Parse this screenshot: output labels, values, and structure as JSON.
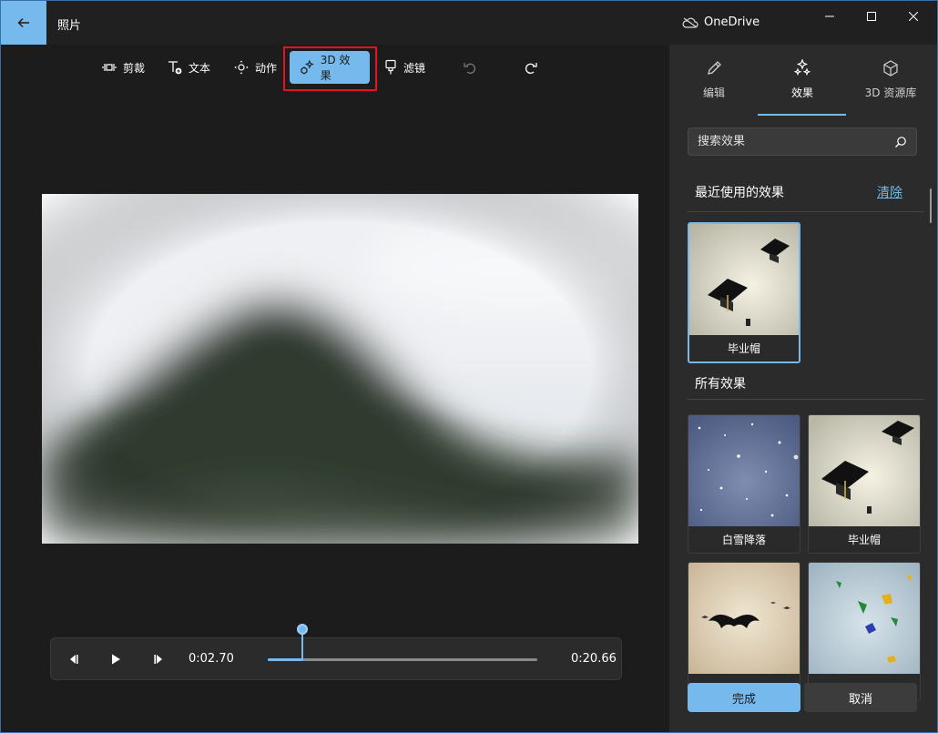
{
  "app": {
    "title": "照片",
    "onedrive_label": "OneDrive"
  },
  "toolbar": {
    "trim": "剪裁",
    "text": "文本",
    "motion": "动作",
    "effects3d": "3D 效果",
    "filters": "滤镜"
  },
  "player": {
    "current_time": "0:02.70",
    "total_time": "0:20.66",
    "progress": 0.131
  },
  "panel": {
    "tabs": [
      {
        "label": "编辑",
        "icon": "pencil-icon"
      },
      {
        "label": "效果",
        "icon": "sparkles-icon"
      },
      {
        "label": "3D 资源库",
        "icon": "cube-icon"
      }
    ],
    "active_tab": "效果",
    "search_placeholder": "搜索效果",
    "recent_title": "最近使用的效果",
    "clear_label": "清除",
    "all_title": "所有效果",
    "recent": [
      {
        "label": "毕业帽"
      }
    ],
    "all": [
      {
        "label": "白雪降落"
      },
      {
        "label": "毕业帽"
      },
      {
        "label": ""
      },
      {
        "label": ""
      }
    ],
    "done_label": "完成",
    "cancel_label": "取消"
  },
  "colors": {
    "accent": "#76b9ed",
    "highlight": "#e81123",
    "panel_bg": "#2b2b2b"
  }
}
